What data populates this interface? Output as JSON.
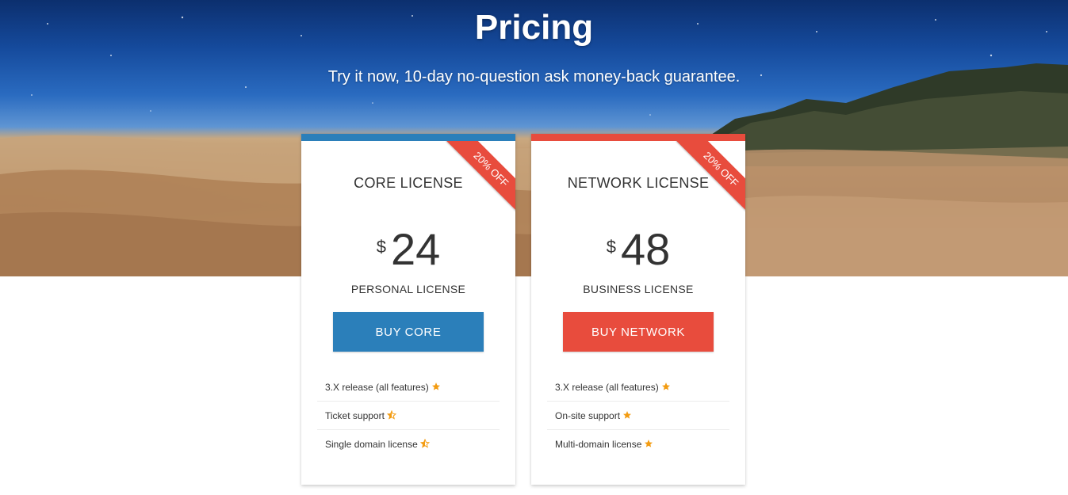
{
  "hero": {
    "title": "Pricing",
    "subtitle": "Try it now, 10-day no-question ask money-back guarantee."
  },
  "colors": {
    "core_accent": "#2b7fba",
    "network_accent": "#e84c3d",
    "ribbon": "#e84c3d",
    "star": "#f39c12"
  },
  "plans": [
    {
      "ribbon": "20% OFF",
      "name": "CORE LICENSE",
      "currency": "$",
      "price": "24",
      "license_type": "PERSONAL LICENSE",
      "button_label": "BUY CORE",
      "features": [
        {
          "text": "3.X release (all features)",
          "icon": "star-full-icon"
        },
        {
          "text": "Ticket support",
          "icon": "star-half-icon"
        },
        {
          "text": "Single domain license",
          "icon": "star-half-icon"
        }
      ]
    },
    {
      "ribbon": "20% OFF",
      "name": "NETWORK LICENSE",
      "currency": "$",
      "price": "48",
      "license_type": "BUSINESS LICENSE",
      "button_label": "BUY NETWORK",
      "features": [
        {
          "text": "3.X release (all features)",
          "icon": "star-full-icon"
        },
        {
          "text": "On-site support",
          "icon": "star-full-icon"
        },
        {
          "text": "Multi-domain license",
          "icon": "star-full-icon"
        }
      ]
    }
  ]
}
